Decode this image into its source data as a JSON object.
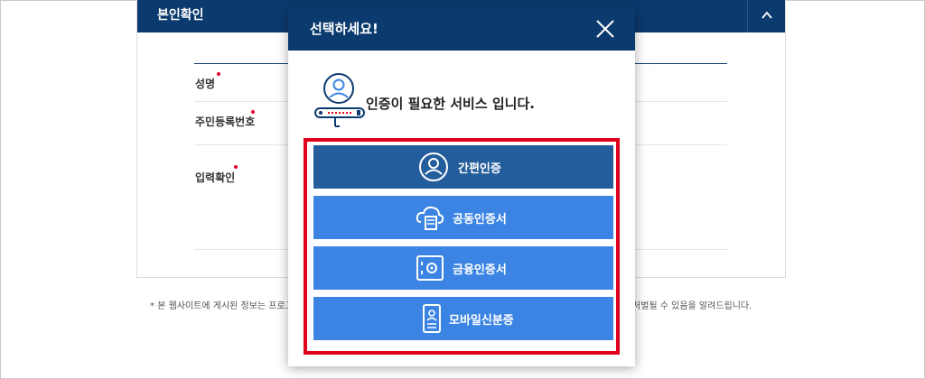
{
  "background": {
    "panel_title": "본인확인",
    "fields": [
      {
        "label": "성명"
      },
      {
        "label": "주민등록번호"
      },
      {
        "label": "입력확인"
      }
    ],
    "footnote_left": "본 웹사이트에 게시된 정보는 프로그",
    "footnote_right": "처벌될 수 있음을 알려드립니다."
  },
  "modal": {
    "title": "선택하세요!",
    "intro": "인증이 필요한 서비스 입니다.",
    "options": [
      {
        "label": "간편인증",
        "icon": "user-circle-icon"
      },
      {
        "label": "공동인증서",
        "icon": "cloud-certificate-icon"
      },
      {
        "label": "금융인증서",
        "icon": "safe-icon"
      },
      {
        "label": "모바일신분증",
        "icon": "mobile-id-icon"
      }
    ]
  },
  "colors": {
    "header_navy": "#0b3a6e",
    "primary_button": "#245d9b",
    "secondary_button": "#3b84e3",
    "highlight_red": "#e0001b",
    "required_dot": "#e4002b"
  }
}
